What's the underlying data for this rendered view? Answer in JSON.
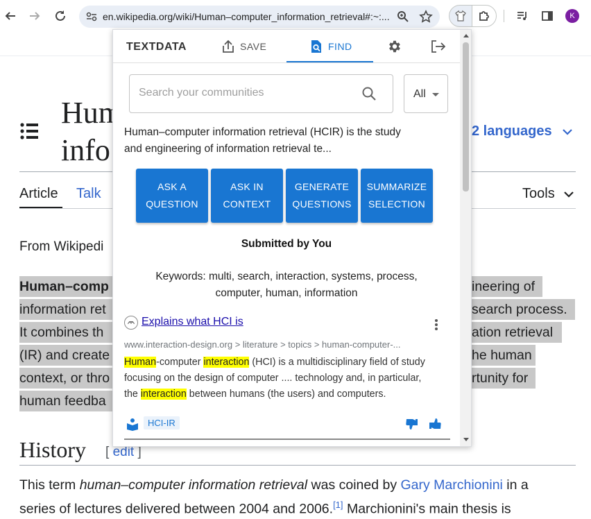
{
  "browser": {
    "url": "en.wikipedia.org/wiki/Human–computer_information_retrieval#:~:...",
    "avatar_letter": "K",
    "accent": "#7b1fa2"
  },
  "wiki": {
    "title_line1": "Hum",
    "title_line2": "info",
    "languages": "2 languages",
    "tab_article": "Article",
    "tab_talk": "Talk",
    "tab_tools": "Tools",
    "from": "From Wikipedi",
    "para_lines_left": [
      "Human–comp",
      "information ret",
      "It combines th",
      "(IR) and create",
      "context, or thro",
      "human feedba"
    ],
    "para_lines_right": [
      "ineering of",
      "search process.",
      "ation retrieval",
      "he human",
      "rtunity for"
    ],
    "history_heading": "History",
    "edit_open": "[ ",
    "edit_label": "edit",
    "edit_close": " ]",
    "body_line1_a": "This term ",
    "body_line1_em": "human–computer information retrieval",
    "body_line1_b": " was coined by ",
    "body_line1_link": "Gary Marchionini",
    "body_line1_c": " in a",
    "body_line2_a": "series of lectures delivered between 2004 and 2006.",
    "body_line2_sup": "[1]",
    "body_line2_b": " Marchionini's main thesis is",
    "link_color": "#3366cc"
  },
  "popup": {
    "brand": "TEXTDATA",
    "tab_save": "SAVE",
    "tab_find": "FIND",
    "accent": "#1976d2",
    "search": {
      "placeholder": "Search your communities",
      "value": ""
    },
    "filter_value": "All",
    "snippet_line1": "Human–computer information retrieval (HCIR) is the study",
    "snippet_line2": "and engineering of information retrieval te...",
    "buttons": [
      {
        "line1": "ASK A",
        "line2": "QUESTION"
      },
      {
        "line1": "ASK IN",
        "line2": "CONTEXT"
      },
      {
        "line1": "GENERATE",
        "line2": "QUESTIONS"
      },
      {
        "line1": "SUMMARIZE",
        "line2": "SELECTION"
      }
    ],
    "submitted_by": "Submitted by You",
    "keywords_line1": "Keywords: multi, search, interaction, systems, process,",
    "keywords_line2": "computer, human, information",
    "result": {
      "title": "Explains what HCI is",
      "url": "www.interaction-design.org > literature > topics > human-computer-...",
      "hl1": "Human",
      "t1": "-computer ",
      "hl2": "interaction",
      "t2": " (HCI) is a multidisciplinary field of study",
      "line2": "focusing on the design of computer .... technology and, in particular,",
      "t3": "the ",
      "hl3": "interaction",
      "t4": " between humans (the users) and computers.",
      "tag": "HCI-IR",
      "highlight_color": "#ffff00"
    }
  }
}
